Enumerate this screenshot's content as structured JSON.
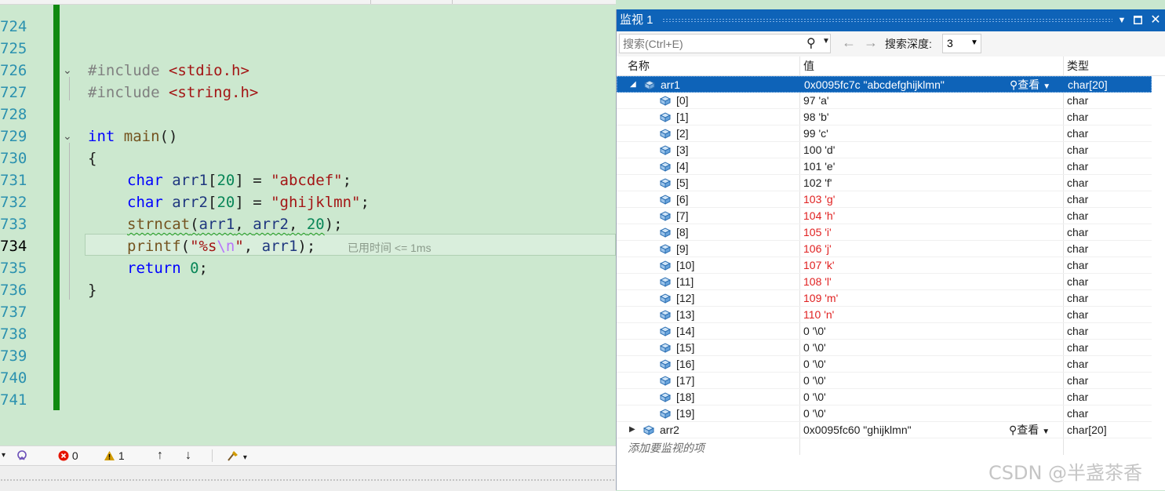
{
  "editor": {
    "line_numbers": [
      "724",
      "725",
      "726",
      "727",
      "728",
      "729",
      "730",
      "731",
      "732",
      "733",
      "734",
      "735",
      "736",
      "737",
      "738",
      "739",
      "740",
      "741"
    ],
    "current_line": "734",
    "lines": {
      "l726": {
        "kw": "#include",
        "hdr": "<stdio.h>"
      },
      "l727": {
        "kw": "#include",
        "hdr": "<string.h>"
      },
      "l729": {
        "type": "int",
        "fn": "main",
        "rest": "()"
      },
      "l730": "{",
      "l731": {
        "type": "char",
        "var": "arr1",
        "idx": "[",
        "num": "20",
        "mid": "] = ",
        "str": "\"abcdef\"",
        "end": ";"
      },
      "l732": {
        "type": "char",
        "var": "arr2",
        "idx": "[",
        "num": "20",
        "mid": "] = ",
        "str": "\"ghijklmn\"",
        "end": ";"
      },
      "l733": {
        "fn": "strncat",
        "open": "(",
        "a1": "arr1",
        "c1": ", ",
        "a2": "arr2",
        "c2": ", ",
        "num": "20",
        "end": ");"
      },
      "l734": {
        "fn": "printf",
        "open": "(",
        "s1": "\"%s",
        "esc": "\\n",
        "s2": "\"",
        "c1": ", ",
        "a1": "arr1",
        "end": ");"
      },
      "l735": {
        "kw": "return",
        "num": "0",
        "end": ";"
      },
      "l736": "}"
    },
    "elapsed_hint": "已用时间 <= 1ms"
  },
  "status": {
    "errors": "0",
    "warnings": "1"
  },
  "watch": {
    "title": "监视 1",
    "search_placeholder": "搜索(Ctrl+E)",
    "depth_label": "搜索深度:",
    "depth_value": "3",
    "columns": {
      "name": "名称",
      "value": "值",
      "type": "类型"
    },
    "view_label": "查看",
    "add_item": "添加要监视的项",
    "rows": [
      {
        "name": "arr1",
        "value": "0x0095fc7c \"abcdefghijklmn\"",
        "type": "char[20]"
      },
      {
        "name": "[0]",
        "value": "97 'a'",
        "type": "char"
      },
      {
        "name": "[1]",
        "value": "98 'b'",
        "type": "char"
      },
      {
        "name": "[2]",
        "value": "99 'c'",
        "type": "char"
      },
      {
        "name": "[3]",
        "value": "100 'd'",
        "type": "char"
      },
      {
        "name": "[4]",
        "value": "101 'e'",
        "type": "char"
      },
      {
        "name": "[5]",
        "value": "102 'f'",
        "type": "char"
      },
      {
        "name": "[6]",
        "value": "103 'g'",
        "type": "char"
      },
      {
        "name": "[7]",
        "value": "104 'h'",
        "type": "char"
      },
      {
        "name": "[8]",
        "value": "105 'i'",
        "type": "char"
      },
      {
        "name": "[9]",
        "value": "106 'j'",
        "type": "char"
      },
      {
        "name": "[10]",
        "value": "107 'k'",
        "type": "char"
      },
      {
        "name": "[11]",
        "value": "108 'l'",
        "type": "char"
      },
      {
        "name": "[12]",
        "value": "109 'm'",
        "type": "char"
      },
      {
        "name": "[13]",
        "value": "110 'n'",
        "type": "char"
      },
      {
        "name": "[14]",
        "value": "0 '\\0'",
        "type": "char"
      },
      {
        "name": "[15]",
        "value": "0 '\\0'",
        "type": "char"
      },
      {
        "name": "[16]",
        "value": "0 '\\0'",
        "type": "char"
      },
      {
        "name": "[17]",
        "value": "0 '\\0'",
        "type": "char"
      },
      {
        "name": "[18]",
        "value": "0 '\\0'",
        "type": "char"
      },
      {
        "name": "[19]",
        "value": "0 '\\0'",
        "type": "char"
      },
      {
        "name": "arr2",
        "value": "0x0095fc60 \"ghijklmn\"",
        "type": "char[20]"
      }
    ]
  },
  "watermark": "CSDN @半盏茶香",
  "colors": {
    "accent": "#0e63b8",
    "changed_value": "#e02020",
    "margin_bar": "#108a10"
  }
}
